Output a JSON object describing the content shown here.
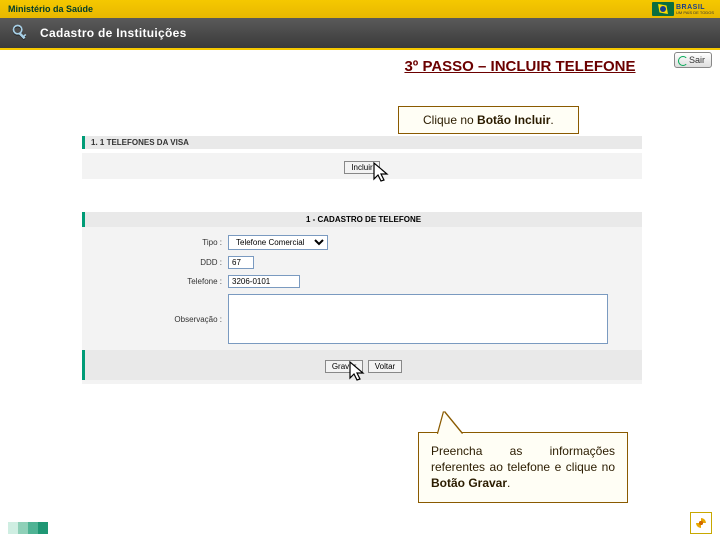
{
  "topbar": {
    "ministry": "Ministério da Saúde",
    "brasil": "BRASIL",
    "tagline": "UM PAÍS DE TODOS"
  },
  "header": {
    "title": "Cadastro de Instituições"
  },
  "step_title": "3º PASSO – INCLUIR TELEFONE",
  "sair_label": "Sair",
  "callout1": {
    "pre": "Clique no ",
    "bold": "Botão Incluir",
    "post": "."
  },
  "section1": {
    "heading": "1. 1   TELEFONES DA VISA",
    "incluir_btn": "Incluir"
  },
  "section2": {
    "heading": "1 - CADASTRO DE TELEFONE",
    "tipo_label": "Tipo :",
    "tipo_value": "Telefone Comercial",
    "ddd_label": "DDD :",
    "ddd_value": "67",
    "telefone_label": "Telefone :",
    "telefone_value": "3206-0101",
    "obs_label": "Observação :",
    "obs_value": "",
    "gravar_btn": "Gravar",
    "voltar_btn": "Voltar"
  },
  "callout2": {
    "text_pre": "Preencha as informações referentes ao telefone e clique no ",
    "bold": "Botão Gravar",
    "post": "."
  }
}
